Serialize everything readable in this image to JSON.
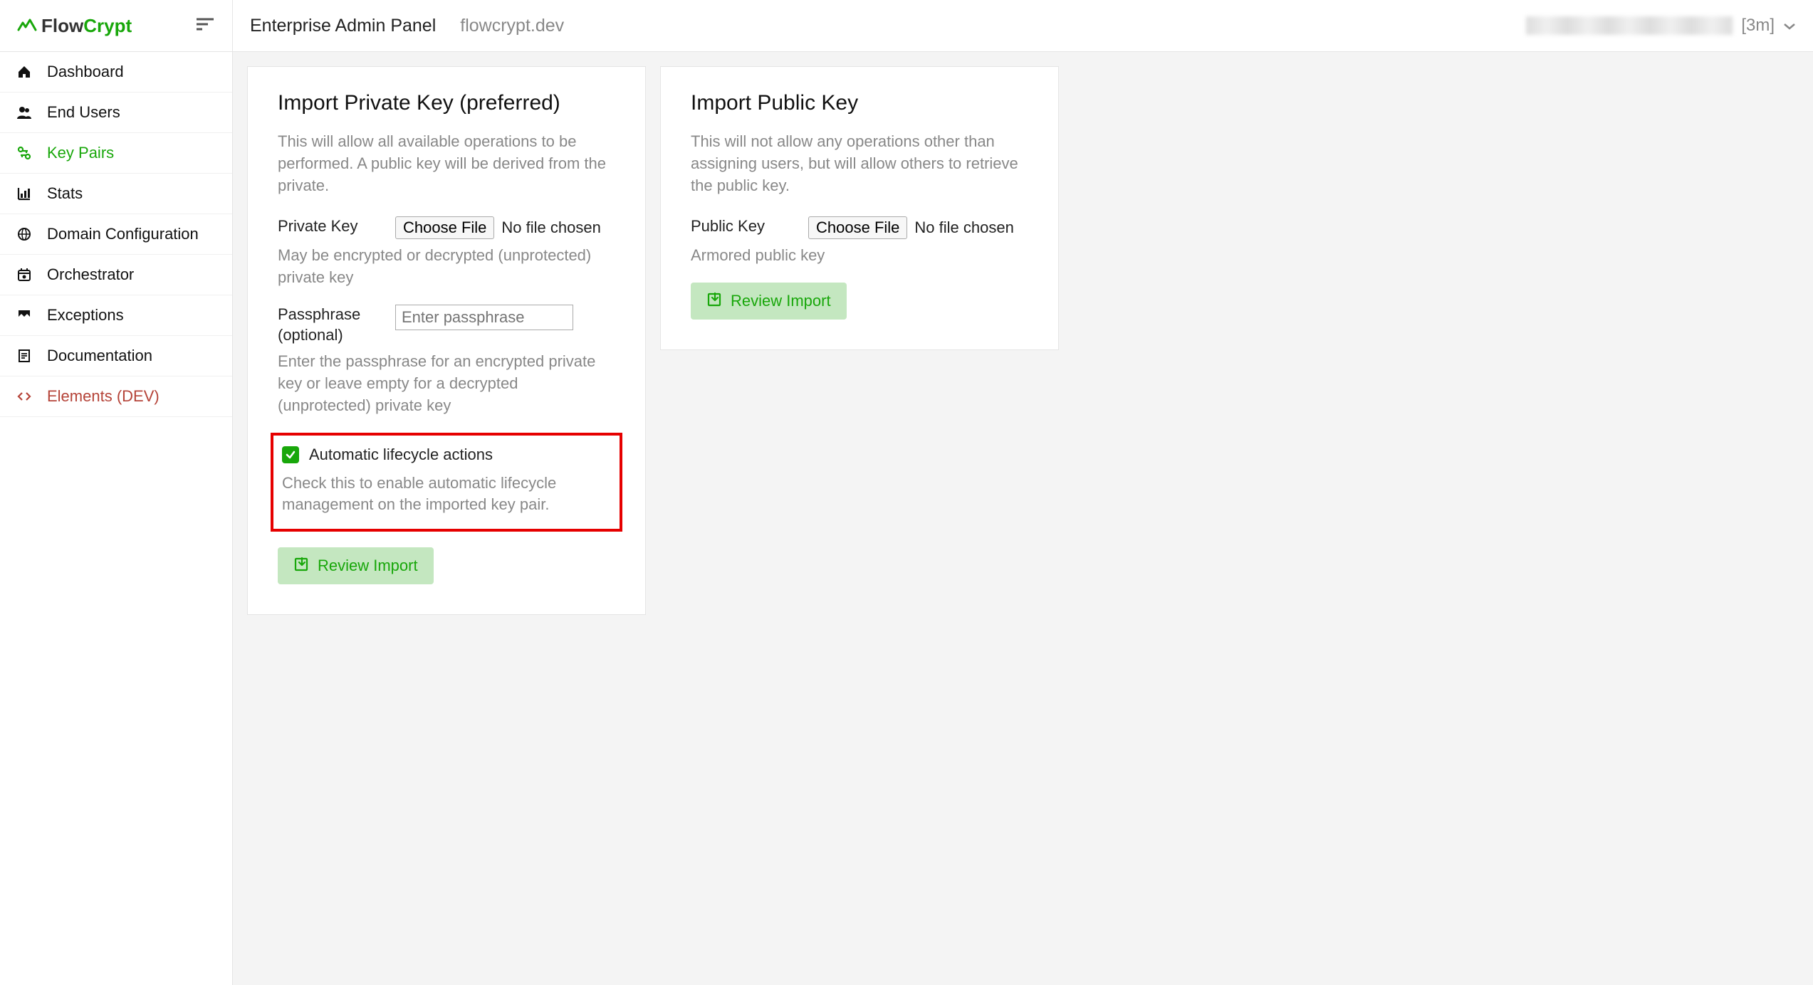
{
  "header": {
    "logo_flow": "Flow",
    "logo_crypt": "Crypt",
    "panel_title": "Enterprise Admin Panel",
    "domain": "flowcrypt.dev",
    "session_time": "[3m]"
  },
  "sidebar": {
    "items": [
      {
        "label": "Dashboard"
      },
      {
        "label": "End Users"
      },
      {
        "label": "Key Pairs"
      },
      {
        "label": "Stats"
      },
      {
        "label": "Domain Configuration"
      },
      {
        "label": "Orchestrator"
      },
      {
        "label": "Exceptions"
      },
      {
        "label": "Documentation"
      },
      {
        "label": "Elements (DEV)"
      }
    ]
  },
  "private_card": {
    "title": "Import Private Key (preferred)",
    "desc": "This will allow all available operations to be performed. A public key will be derived from the private.",
    "private_key_label": "Private Key",
    "choose_file": "Choose File",
    "no_file": "No file chosen",
    "private_key_helper": "May be encrypted or decrypted (unprotected) private key",
    "passphrase_label": "Passphrase (optional)",
    "passphrase_placeholder": "Enter passphrase",
    "passphrase_helper": "Enter the passphrase for an encrypted private key or leave empty for a decrypted (unprotected) private key",
    "alc_label": "Automatic lifecycle actions",
    "alc_helper": "Check this to enable automatic lifecycle management on the imported key pair.",
    "review_btn": "Review Import"
  },
  "public_card": {
    "title": "Import Public Key",
    "desc": "This will not allow any operations other than assigning users, but will allow others to retrieve the public key.",
    "public_key_label": "Public Key",
    "choose_file": "Choose File",
    "no_file": "No file chosen",
    "public_key_helper": "Armored public key",
    "review_btn": "Review Import"
  }
}
